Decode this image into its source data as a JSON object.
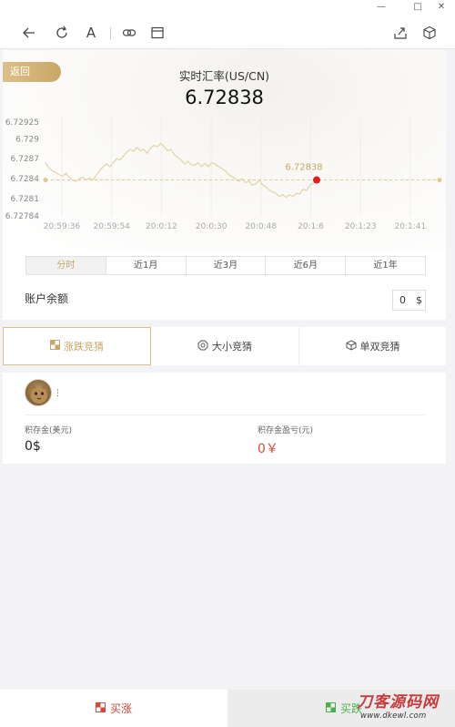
{
  "window": {
    "min_icon": "—",
    "max_icon": "□",
    "close_icon": "✕"
  },
  "toolbar": {
    "back_icon": "arrow-left-icon",
    "refresh_icon": "refresh-icon",
    "font_label": "A",
    "link_icon": "link-icon",
    "window_icon": "window-icon",
    "share_icon": "share-icon",
    "cube_icon": "cube-icon"
  },
  "header": {
    "back_label": "返回",
    "title": "实时汇率(US/CN)",
    "rate": "6.72838"
  },
  "chart_data": {
    "type": "line",
    "x_ticks": [
      "20:59:36",
      "20:59:54",
      "20:0:12",
      "20:0:30",
      "20:0:48",
      "20:1:6",
      "20:1:23",
      "20:1:41"
    ],
    "y_ticks": [
      "6.72925",
      "6.729",
      "6.7287",
      "6.7284",
      "6.7281",
      "6.72784"
    ],
    "ylim": [
      6.72784,
      6.72925
    ],
    "reference_value": 6.72838,
    "current_label": "6.72838",
    "colors": {
      "line": "#e3d7a9",
      "dash": "#e0c98f",
      "dot": "#e02020",
      "label": "#c8a566"
    },
    "series": [
      {
        "values": [
          6.72864,
          6.72856,
          6.72852,
          6.72849,
          6.72846,
          6.72844,
          6.72848,
          6.72842,
          6.72838,
          6.72836,
          6.7284,
          6.72842,
          6.72838,
          6.72841,
          6.72838,
          6.72845,
          6.72852,
          6.72858,
          6.72862,
          6.72858,
          6.72864,
          6.7287,
          6.72868,
          6.72874,
          6.7288,
          6.72884,
          6.72881,
          6.72887,
          6.72882,
          6.72884,
          6.72878,
          6.72886,
          6.7289,
          6.72888,
          6.72893,
          6.72888,
          6.72882,
          6.72884,
          6.72876,
          6.72872,
          6.72868,
          6.72862,
          6.72866,
          6.72861,
          6.7286,
          6.72864,
          6.72858,
          6.72863,
          6.72858,
          6.72864,
          6.72862,
          6.72858,
          6.72855,
          6.72852,
          6.72846,
          6.72843,
          6.7284,
          6.72836,
          6.7284,
          6.72834,
          6.72836,
          6.7283,
          6.72832,
          6.72838,
          6.72831,
          6.72828,
          6.72823,
          6.7282,
          6.72818,
          6.72813,
          6.72816,
          6.72812,
          6.72816,
          6.72813,
          6.72818,
          6.72817,
          6.72824,
          6.72822,
          6.7283,
          6.72833,
          6.72838
        ]
      }
    ]
  },
  "period_tabs": [
    "分时",
    "近1月",
    "近3月",
    "近6月",
    "近1年"
  ],
  "balance": {
    "label": "账户余额",
    "value": "0",
    "unit": "$"
  },
  "guess_tabs": [
    {
      "label": "涨跌竞猜",
      "icon": "up-down-square-icon"
    },
    {
      "label": "大小竞猜",
      "icon": "octagon-icon"
    },
    {
      "label": "单双竞猜",
      "icon": "cube-icon"
    }
  ],
  "user": {
    "dots": "⋮"
  },
  "stats": {
    "deposit_label": "积存金(美元)",
    "deposit_value": "0$",
    "pnl_label": "积存金盈亏(元)",
    "pnl_value": "0￥"
  },
  "actions": {
    "buy_up": "买涨",
    "buy_down": "买跌"
  },
  "watermark": {
    "title": "刀客源码网",
    "url": "www.dkewl.com"
  }
}
